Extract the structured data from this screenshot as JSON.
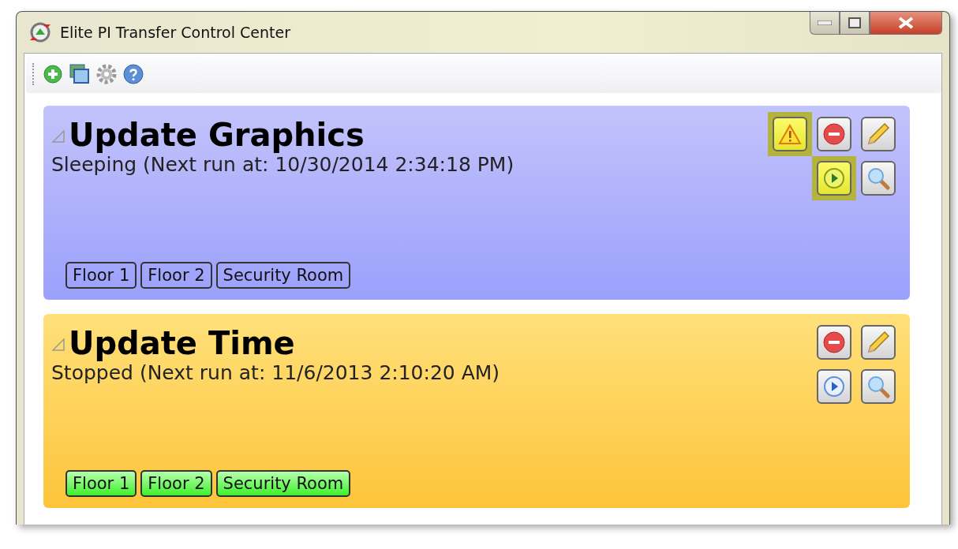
{
  "window": {
    "title": "Elite PI Transfer Control Center"
  },
  "tasks": [
    {
      "title": "Update Graphics",
      "status": "Sleeping (Next run at: 10/30/2014 2:34:18 PM)",
      "kind": "sleeping",
      "warning": true,
      "play_highlighted": true,
      "tags": [
        {
          "label": "Floor 1",
          "active": false
        },
        {
          "label": "Floor 2",
          "active": false
        },
        {
          "label": "Security Room",
          "active": false
        }
      ]
    },
    {
      "title": "Update Time",
      "status": "Stopped (Next run at: 11/6/2013 2:10:20 AM)",
      "kind": "stopped",
      "warning": false,
      "play_highlighted": false,
      "tags": [
        {
          "label": "Floor 1",
          "active": true
        },
        {
          "label": "Floor 2",
          "active": true
        },
        {
          "label": "Security Room",
          "active": true
        }
      ]
    }
  ]
}
